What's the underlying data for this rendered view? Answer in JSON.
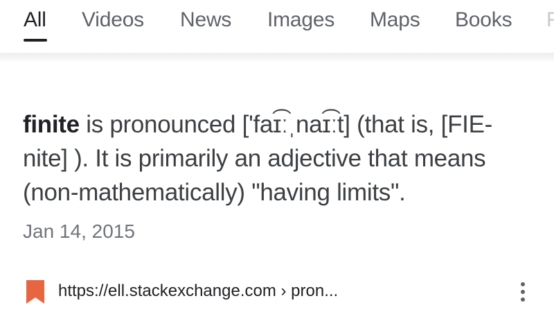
{
  "tabs": [
    {
      "label": "All",
      "active": true
    },
    {
      "label": "Videos",
      "active": false
    },
    {
      "label": "News",
      "active": false
    },
    {
      "label": "Images",
      "active": false
    },
    {
      "label": "Maps",
      "active": false
    },
    {
      "label": "Books",
      "active": false
    },
    {
      "label": "F",
      "active": false
    }
  ],
  "snippet": {
    "term": "finite",
    "text_1": " is pronounced ['faɪ͡ːˌnaɪ͡ːt] (that is, [FIE-nite] ). It is primarily an adjective that means (non-mathematically) \"having limits\".",
    "date": "Jan 14, 2015"
  },
  "source": {
    "url": "https://ell.stackexchange.com › pron...",
    "bookmark_color": "#e8663f"
  },
  "icons": {
    "bookmark": "bookmark-icon",
    "more": "more-vert-icon"
  }
}
